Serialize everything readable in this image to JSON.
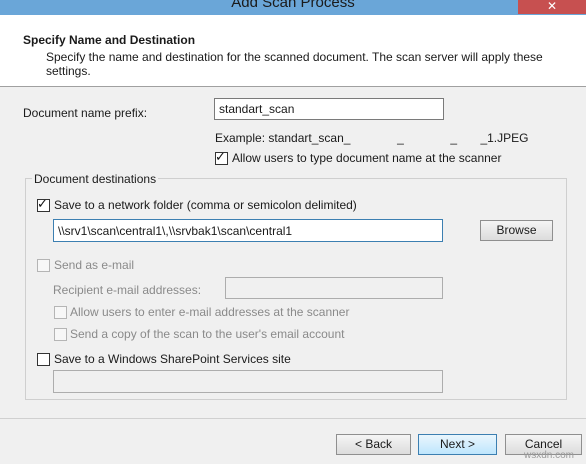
{
  "window": {
    "title": "Add Scan Process",
    "close_glyph": "✕"
  },
  "header": {
    "title": "Specify Name and Destination",
    "description": "Specify the name and destination for the scanned document. The scan server will apply these settings."
  },
  "name_section": {
    "prefix_label": "Document name prefix:",
    "prefix_value": "standart_scan",
    "example_text": "Example: standart_scan_              _              _       _1.JPEG",
    "allow_type_label": "Allow users to type document name at the scanner",
    "allow_type_checked": true
  },
  "destinations": {
    "legend": "Document destinations",
    "network_folder": {
      "label": "Save to a network folder (comma or semicolon delimited)",
      "checked": true,
      "path_value": "\\\\srv1\\scan\\central1\\,\\\\srvbak1\\scan\\central1",
      "browse_label": "Browse"
    },
    "email": {
      "label": "Send as e-mail",
      "checked": false,
      "recipient_label": "Recipient e-mail addresses:",
      "recipient_value": "",
      "allow_enter_label": "Allow users to enter e-mail addresses at the scanner",
      "send_copy_label": "Send a copy of the scan to the user's email account"
    },
    "sharepoint": {
      "label": "Save to a Windows SharePoint Services site",
      "checked": false,
      "site_value": ""
    }
  },
  "footer": {
    "back_label": "< Back",
    "next_label": "Next >",
    "cancel_label": "Cancel"
  },
  "watermark": "wsxdn.com",
  "colors": {
    "titlebar": "#6aa6d8",
    "close_button": "#c75050",
    "dialog_bg": "#f0f0f0"
  }
}
